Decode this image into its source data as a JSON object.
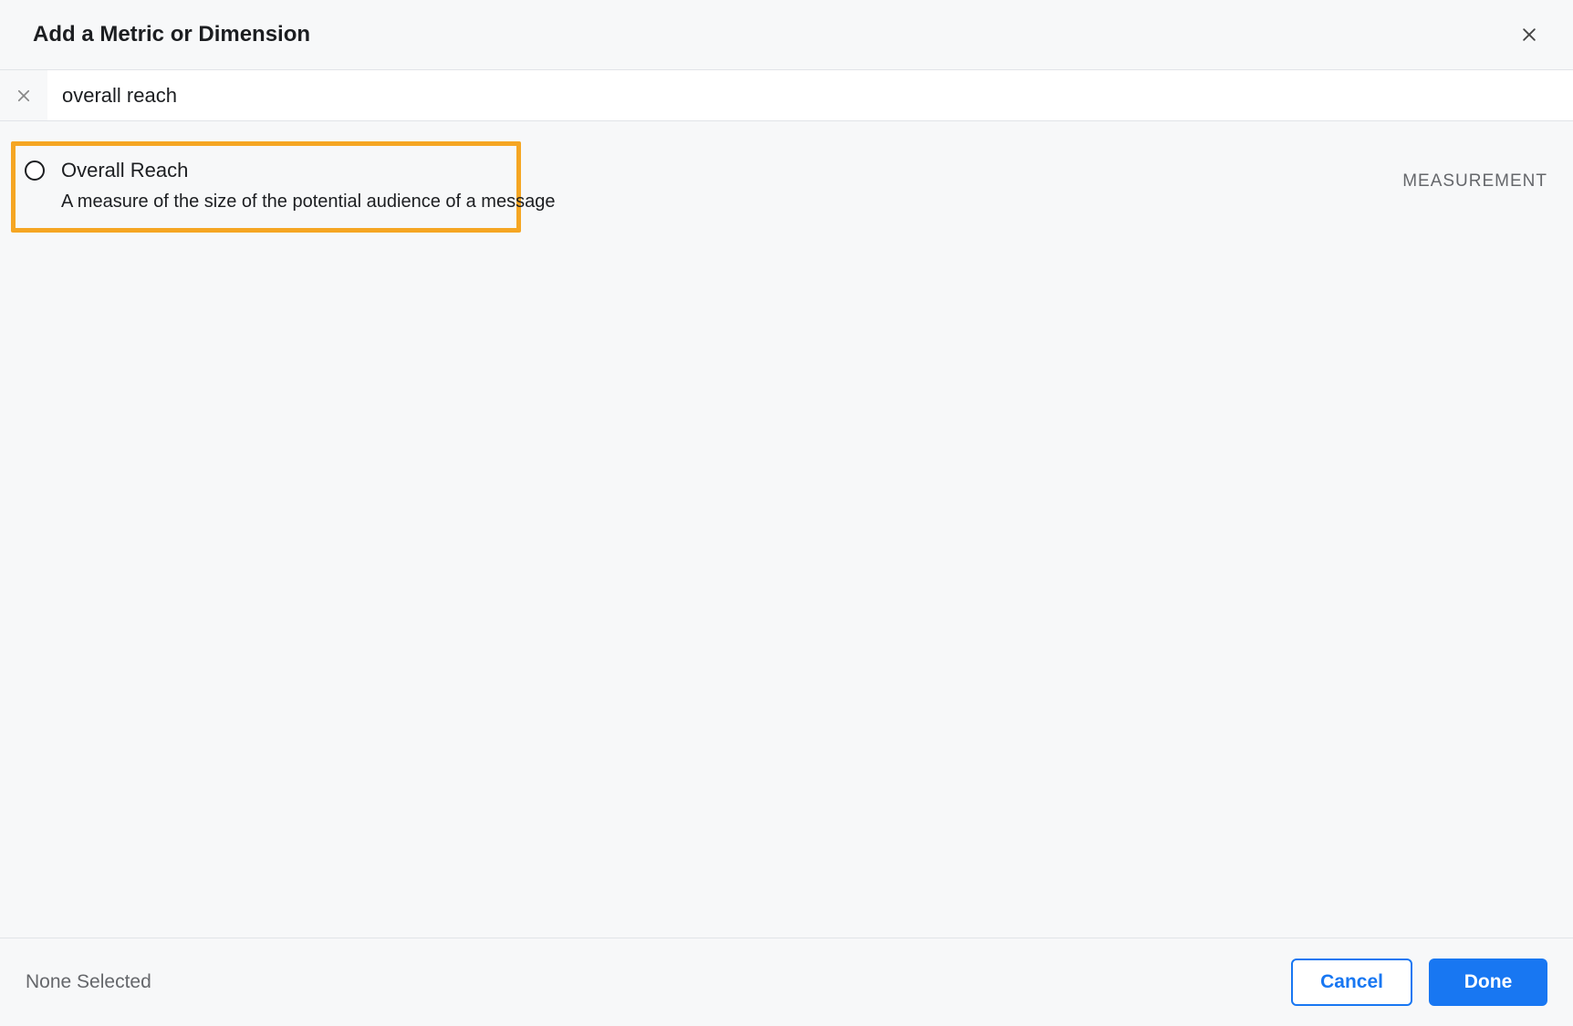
{
  "header": {
    "title": "Add a Metric or Dimension"
  },
  "search": {
    "value": "overall reach"
  },
  "results": [
    {
      "title": "Overall Reach",
      "description": "A measure of the size of the potential audience of a message",
      "category": "MEASUREMENT",
      "highlighted": true
    }
  ],
  "footer": {
    "status": "None Selected",
    "cancel_label": "Cancel",
    "done_label": "Done"
  }
}
